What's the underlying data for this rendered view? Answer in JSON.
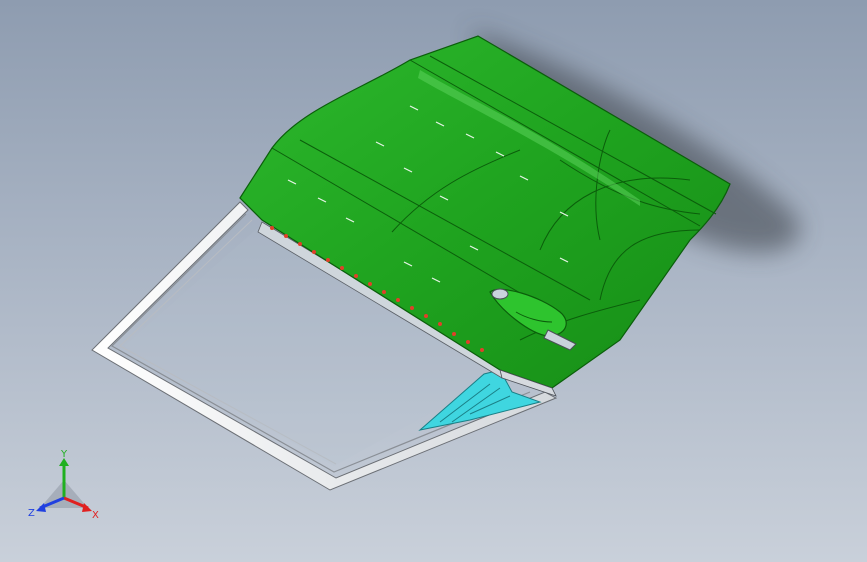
{
  "viewport": {
    "background_top": "#8e9cb0",
    "background_bottom": "#c9d0da"
  },
  "model": {
    "panel_color": "#1fa31f",
    "panel_dark": "#117a11",
    "frame_color": "#f2f2f2",
    "bracket_color": "#3fd6e0",
    "rivet_color": "#e0402a",
    "shadow_color": "#3b3f47"
  },
  "triad": {
    "x_label": "X",
    "y_label": "Y",
    "z_label": "Z",
    "x_color": "#e02020",
    "y_color": "#20b020",
    "z_color": "#2040e0"
  }
}
